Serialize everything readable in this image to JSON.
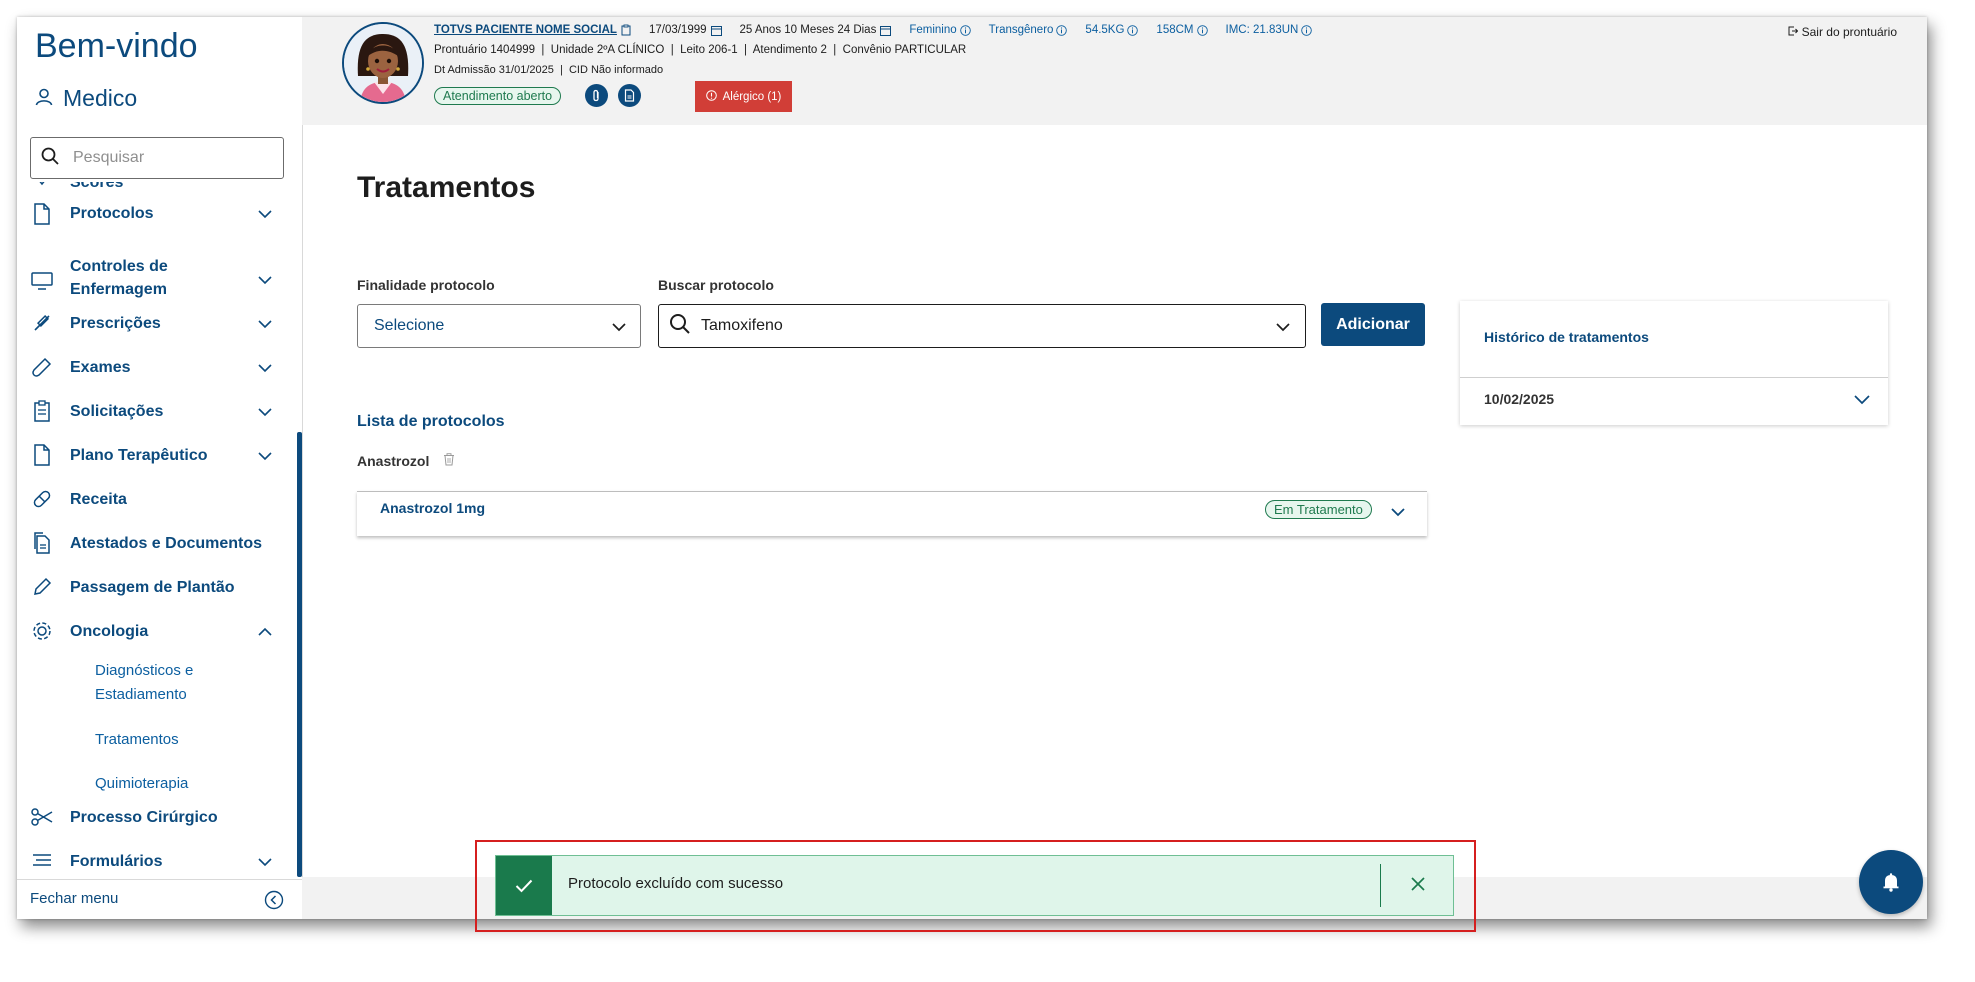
{
  "sidebar": {
    "welcome": "Bem-vindo",
    "user_role": "Medico",
    "search_placeholder": "Pesquisar",
    "partial_item": "Scores",
    "items": [
      {
        "label": "Protocolos"
      },
      {
        "label": "Controles de Enfermagem"
      },
      {
        "label": "Prescrições"
      },
      {
        "label": "Exames"
      },
      {
        "label": "Solicitações"
      },
      {
        "label": "Plano Terapêutico"
      },
      {
        "label": "Receita"
      },
      {
        "label": "Atestados e Documentos"
      },
      {
        "label": "Passagem de Plantão"
      },
      {
        "label": "Oncologia"
      },
      {
        "label": "Processo Cirúrgico"
      },
      {
        "label": "Formulários"
      }
    ],
    "oncologia_sub": [
      "Diagnósticos e Estadiamento",
      "Tratamentos",
      "Quimioterapia"
    ],
    "close_menu": "Fechar menu"
  },
  "header": {
    "patient_name": "TOTVS PACIENTE NOME SOCIAL",
    "birth_date": "17/03/1999",
    "age": "25 Anos 10 Meses 24 Dias",
    "gender": "Feminino",
    "identity": "Transgênero",
    "weight": "54.5KG",
    "height": "158CM",
    "imc": "IMC: 21.83UN",
    "line2": "Prontuário 1404999  |  Unidade 2ºA CLÍNICO  |  Leito 206-1  |  Atendimento 2  |  Convênio PARTICULAR",
    "line3": "Dt Admissão 31/01/2025  |  CID Não informado",
    "status_badge": "Atendimento aberto",
    "allergic": "Alérgico (1)",
    "logout": "Sair do prontuário"
  },
  "main": {
    "title": "Tratamentos",
    "finalidade_label": "Finalidade protocolo",
    "finalidade_value": "Selecione",
    "buscar_label": "Buscar protocolo",
    "buscar_value": "Tamoxifeno",
    "add_button": "Adicionar",
    "list_title": "Lista de protocolos",
    "group_name": "Anastrozol",
    "protocol_name": "Anastrozol 1mg",
    "protocol_status": "Em Tratamento",
    "history_title": "Histórico de tratamentos",
    "history_date": "10/02/2025"
  },
  "toast": {
    "message": "Protocolo excluído com sucesso"
  },
  "colors": {
    "brand": "#0c4a7d",
    "success": "#1a7a4c",
    "danger": "#d13e37"
  }
}
